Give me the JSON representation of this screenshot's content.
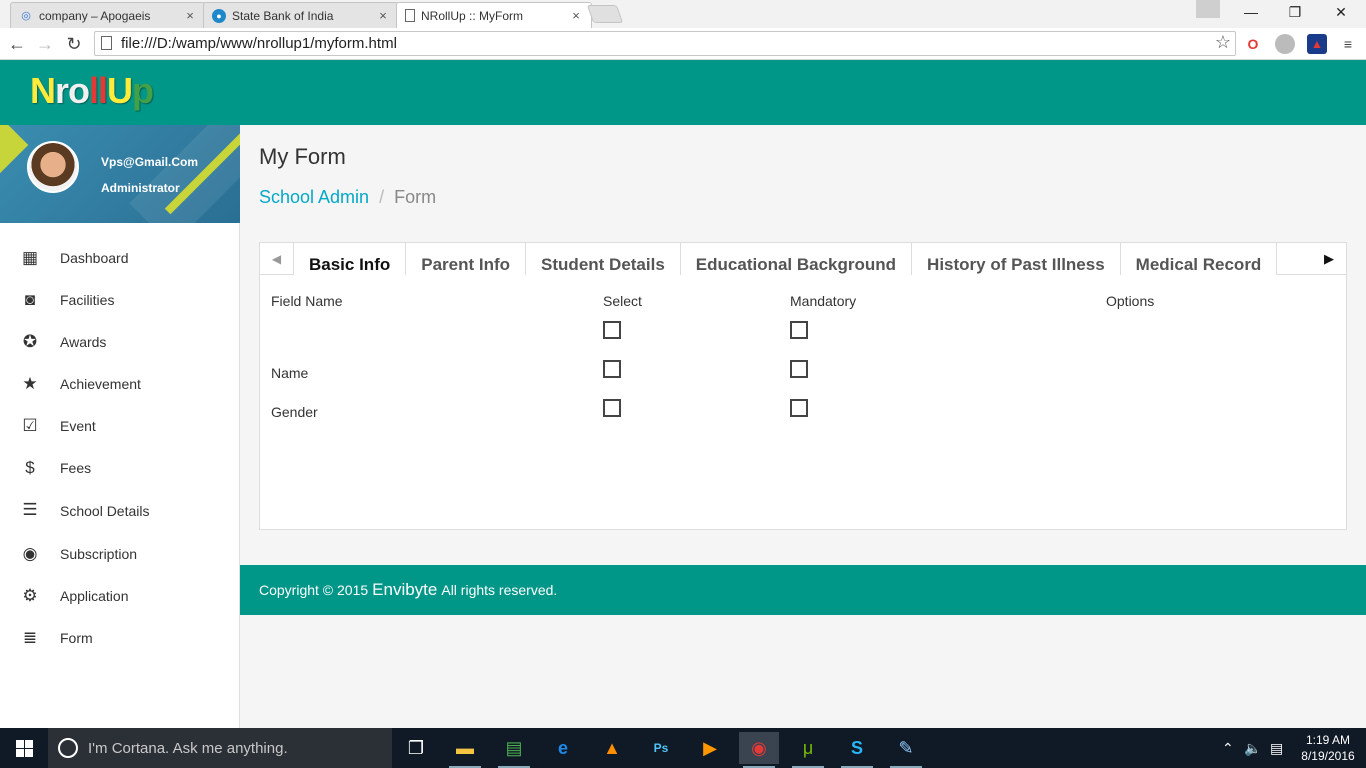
{
  "browser": {
    "tabs": [
      {
        "title": "company – Apogaeis",
        "icon": "globe-icon"
      },
      {
        "title": "State Bank of India",
        "icon": "sbi-icon"
      },
      {
        "title": "NRollUp :: MyForm",
        "icon": "page-icon"
      }
    ],
    "url": "file:///D:/wamp/www/nrollup1/myform.html"
  },
  "app": {
    "logo_letters": [
      {
        "ch": "N",
        "color": "#ffeb3b"
      },
      {
        "ch": "r",
        "color": "#f0f0f0"
      },
      {
        "ch": "o",
        "color": "#f0f0f0"
      },
      {
        "ch": "ll",
        "color": "#e53935"
      },
      {
        "ch": "U",
        "color": "#ffeb3b"
      },
      {
        "ch": "p",
        "color": "#43a047"
      }
    ],
    "accent": "#009688",
    "link_color": "#03a9c8"
  },
  "user": {
    "email": "Vps@Gmail.Com",
    "role": "Administrator"
  },
  "sidebar": {
    "items": [
      {
        "label": "Dashboard",
        "icon": "dashboard-icon"
      },
      {
        "label": "Facilities",
        "icon": "facilities-icon"
      },
      {
        "label": "Awards",
        "icon": "awards-icon"
      },
      {
        "label": "Achievement",
        "icon": "star-icon"
      },
      {
        "label": "Event",
        "icon": "calendar-check-icon"
      },
      {
        "label": "Fees",
        "icon": "dollar-icon"
      },
      {
        "label": "School Details",
        "icon": "list-icon"
      },
      {
        "label": "Subscription",
        "icon": "account-circle-icon"
      },
      {
        "label": "Application",
        "icon": "settings-box-icon"
      },
      {
        "label": "Form",
        "icon": "lines-icon"
      }
    ]
  },
  "page": {
    "title": "My Form",
    "breadcrumb": {
      "link": "School Admin",
      "separator": "/",
      "current": "Form"
    }
  },
  "form_tabs": [
    "Basic Info",
    "Parent Info",
    "Student Details",
    "Educational Background",
    "History of Past Illness",
    "Medical Record"
  ],
  "active_tab": "Basic Info",
  "form_table": {
    "headers": {
      "field": "Field Name",
      "select": "Select",
      "mandatory": "Mandatory",
      "options": "Options"
    },
    "rows": [
      {
        "field": "",
        "select": false,
        "mandatory": false
      },
      {
        "field": "Name",
        "select": false,
        "mandatory": false
      },
      {
        "field": "Gender",
        "select": false,
        "mandatory": false
      }
    ]
  },
  "footer": {
    "prefix": "Copyright © 2015",
    "brand": "Envibyte",
    "suffix": "All rights reserved."
  },
  "taskbar": {
    "search_placeholder": "I'm Cortana. Ask me anything.",
    "time": "1:19 AM",
    "date": "8/19/2016"
  }
}
